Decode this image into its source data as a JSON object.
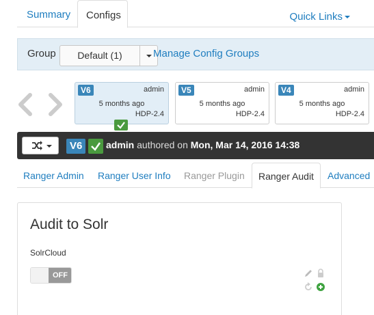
{
  "top_tabs": [
    {
      "label": "Summary",
      "active": false
    },
    {
      "label": "Configs",
      "active": true
    }
  ],
  "quick_links": {
    "label": "Quick Links"
  },
  "group_bar": {
    "label": "Group",
    "selected": "Default (1)",
    "manage_link": "Manage Config Groups"
  },
  "versions": [
    {
      "id": "V6",
      "author": "admin",
      "date": "5 months ago",
      "stack": "HDP-2.4",
      "current": true
    },
    {
      "id": "V5",
      "author": "admin",
      "date": "5 months ago",
      "stack": "HDP-2.4",
      "current": false
    },
    {
      "id": "V4",
      "author": "admin",
      "date": "5 months ago",
      "stack": "HDP-2.4",
      "current": false
    }
  ],
  "current_version_bar": {
    "badge": "V6",
    "author": "admin",
    "authored_text": "authored on",
    "datetime": "Mon, Mar 14, 2016 14:38"
  },
  "service_tabs": [
    {
      "label": "Ranger Admin",
      "state": "link"
    },
    {
      "label": "Ranger User Info",
      "state": "link"
    },
    {
      "label": "Ranger Plugin",
      "state": "disabled"
    },
    {
      "label": "Ranger Audit",
      "state": "active"
    },
    {
      "label": "Advanced",
      "state": "link"
    }
  ],
  "panel": {
    "title": "Audit to Solr",
    "field_label": "SolrCloud",
    "toggle_value": "OFF"
  },
  "colors": {
    "link": "#1e7dbf",
    "version_badge": "#3a86b9",
    "check_green": "#4a9a3f",
    "dark_bar": "#333333",
    "group_bar_bg": "#e3eef6"
  },
  "icons": [
    "chevron-left-icon",
    "chevron-right-icon",
    "check-icon",
    "shuffle-icon",
    "pencil-icon",
    "lock-icon",
    "undo-icon",
    "plus-circle-icon"
  ]
}
